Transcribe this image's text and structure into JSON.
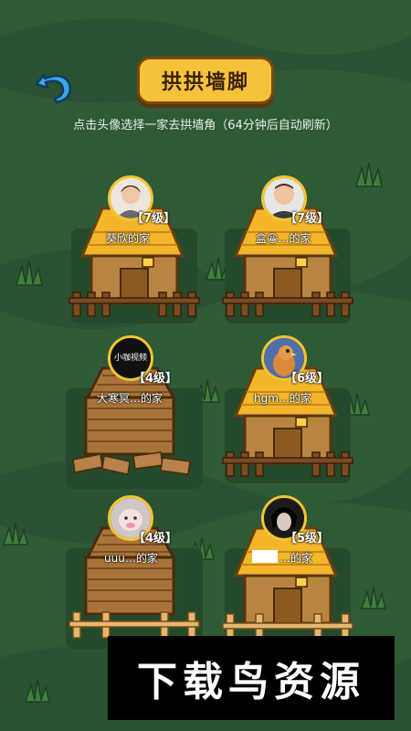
{
  "header": {
    "title": "拱拱墙脚",
    "subtitle": "点击头像选择一家去拱墙角（64分钟后自动刷新）"
  },
  "houses": [
    {
      "level": "【7级】",
      "name": "葵欣的家",
      "roof": "yellow",
      "fence": "dark"
    },
    {
      "level": "【7级】",
      "name": "盒😀…的家",
      "roof": "yellow",
      "fence": "dark"
    },
    {
      "level": "【4级】",
      "name": "大寒冥…的家",
      "roof": "wood",
      "fence": "broken"
    },
    {
      "level": "【6级】",
      "name": "hgm…的家",
      "roof": "yellow",
      "fence": "dark"
    },
    {
      "level": "【4级】",
      "name": "uuu…的家",
      "roof": "wood",
      "fence": "light"
    },
    {
      "level": "【5级】",
      "name": "…的家",
      "roof": "yellow",
      "fence": "light"
    }
  ],
  "avatar_1_text": "小咖视频",
  "watermark": "下载鸟资源",
  "colors": {
    "background": "#2f5a36",
    "button_yellow": "#f6c23a",
    "roof_yellow": "#f3b62a",
    "wall_brown": "#b78442"
  }
}
